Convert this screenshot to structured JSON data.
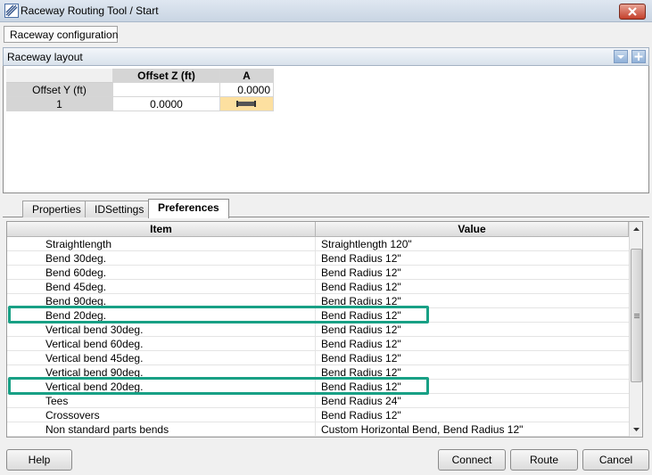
{
  "window": {
    "title": "Raceway Routing Tool / Start"
  },
  "config_button": "Raceway configuration",
  "layout_panel": {
    "title": "Raceway layout",
    "table": {
      "col_offset_z": "Offset Z (ft)",
      "col_a": "A",
      "row_offset_y_label": "Offset Y (ft)",
      "row_offset_y_a": "0.0000",
      "row1_label": "1",
      "row1_offset_z": "0.0000"
    }
  },
  "tabs": [
    {
      "label": "Properties",
      "active": false
    },
    {
      "label": "IDSettings",
      "active": false
    },
    {
      "label": "Preferences",
      "active": true
    }
  ],
  "preferences": {
    "headers": {
      "item": "Item",
      "value": "Value"
    },
    "rows": [
      {
        "item": "Straightlength",
        "value": "Straightlength 120\""
      },
      {
        "item": "Bend 30deg.",
        "value": "Bend Radius 12\""
      },
      {
        "item": "Bend 60deg.",
        "value": "Bend Radius 12\""
      },
      {
        "item": "Bend 45deg.",
        "value": "Bend Radius 12\""
      },
      {
        "item": "Bend 90deg.",
        "value": "Bend Radius 12\""
      },
      {
        "item": "Bend 20deg.",
        "value": "Bend Radius 12\""
      },
      {
        "item": "Vertical bend 30deg.",
        "value": "Bend Radius 12\""
      },
      {
        "item": "Vertical bend 60deg.",
        "value": "Bend Radius 12\""
      },
      {
        "item": "Vertical bend 45deg.",
        "value": "Bend Radius 12\""
      },
      {
        "item": "Vertical bend 90deg.",
        "value": "Bend Radius 12\""
      },
      {
        "item": "Vertical bend 20deg.",
        "value": "Bend Radius 12\""
      },
      {
        "item": "Tees",
        "value": "Bend Radius 24\""
      },
      {
        "item": "Crossovers",
        "value": "Bend Radius 12\""
      },
      {
        "item": "Non standard parts bends",
        "value": "Custom Horizontal Bend, Bend Radius 12\""
      }
    ]
  },
  "buttons": {
    "help": "Help",
    "connect": "Connect",
    "route": "Route",
    "cancel": "Cancel"
  },
  "colors": {
    "highlight": "#18a085",
    "selected_cell": "#fde0a0",
    "close_button": "#c4402b"
  },
  "icons": {
    "app": "raceway-tool-icon",
    "close": "close-icon",
    "collapse": "chevron-down-icon",
    "add": "plus-icon",
    "cell_preview": "raceway-segment-icon"
  }
}
